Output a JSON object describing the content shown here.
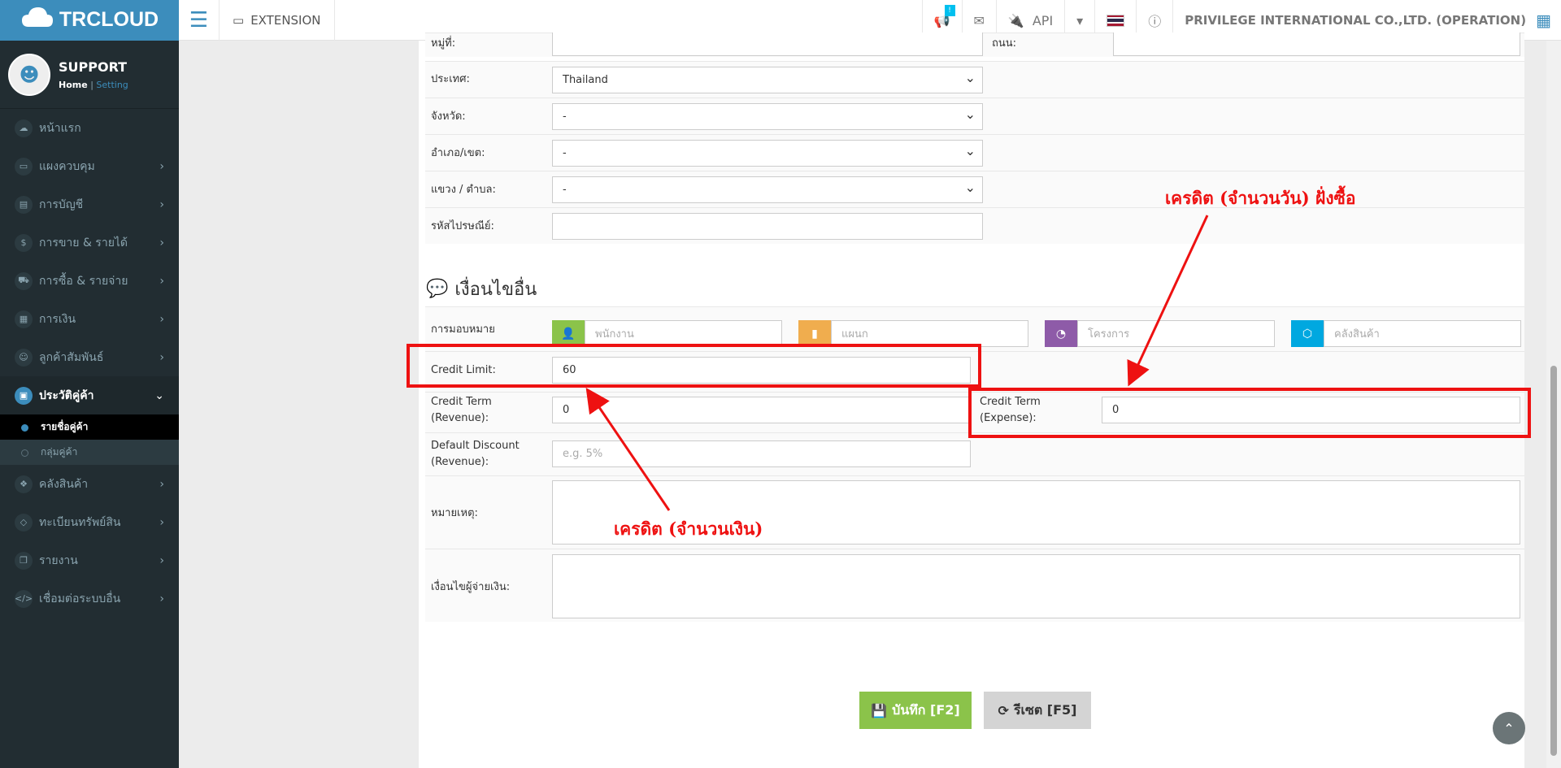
{
  "topbar": {
    "brand": "TRCLOUD",
    "extension": "EXTENSION",
    "api": "API",
    "notif_badge": "!",
    "company": "PRIVILEGE INTERNATIONAL CO.,LTD. (OPERATION)"
  },
  "user": {
    "name": "SUPPORT",
    "home": "Home",
    "setting": "Setting"
  },
  "sidebar": {
    "items": [
      {
        "label": "หน้าแรก"
      },
      {
        "label": "แผงควบคุม"
      },
      {
        "label": "การบัญชี"
      },
      {
        "label": "การขาย & รายได้"
      },
      {
        "label": "การซื้อ & รายจ่าย"
      },
      {
        "label": "การเงิน"
      },
      {
        "label": "ลูกค้าสัมพันธ์"
      },
      {
        "label": "ประวัติคู่ค้า"
      },
      {
        "label": "คลังสินค้า"
      },
      {
        "label": "ทะเบียนทรัพย์สิน"
      },
      {
        "label": "รายงาน"
      },
      {
        "label": "เชื่อมต่อระบบอื่น"
      }
    ],
    "sub": [
      {
        "label": "รายชื่อคู่ค้า"
      },
      {
        "label": "กลุ่มคู่ค้า"
      }
    ]
  },
  "address": {
    "moo_label": "หมู่ที่:",
    "road_label": "ถนน:",
    "country_label": "ประเทศ:",
    "country_value": "Thailand",
    "province_label": "จังหวัด:",
    "province_value": "-",
    "district_label": "อำเภอ/เขต:",
    "district_value": "-",
    "subdistrict_label": "แขวง / ตำบล:",
    "subdistrict_value": "-",
    "postal_label": "รหัสไปรษณีย์:"
  },
  "other": {
    "title": "เงื่อนไขอื่น",
    "assign_label": "การมอบหมาย",
    "employee_ph": "พนักงาน",
    "department_ph": "แผนก",
    "project_ph": "โครงการ",
    "warehouse_ph": "คลังสินค้า",
    "credit_limit_label": "Credit Limit:",
    "credit_limit_value": "60",
    "credit_term_rev_label": "Credit Term (Revenue):",
    "credit_term_rev_value": "0",
    "credit_term_exp_label": "Credit Term (Expense):",
    "credit_term_exp_value": "0",
    "default_discount_label": "Default Discount (Revenue):",
    "default_discount_ph": "e.g. 5%",
    "remark_label": "หมายเหตุ:",
    "payer_label": "เงื่อนไขผู้จ่ายเงิน:"
  },
  "annotations": {
    "credit_days": "เครดิต (จำนวนวัน) ฝั่งซื้อ",
    "credit_money": "เครดิต (จำนวนเงิน)"
  },
  "buttons": {
    "save": "บันทึก [F2]",
    "reset": "รีเซต [F5]"
  },
  "colors": {
    "brand": "#3c8dbc",
    "save_btn": "#8bc34a",
    "annotation": "#ee1111",
    "addon_employee": "#8bc34a",
    "addon_department": "#f0ad4e",
    "addon_project": "#8e5ba8",
    "addon_warehouse": "#00a8e0"
  }
}
